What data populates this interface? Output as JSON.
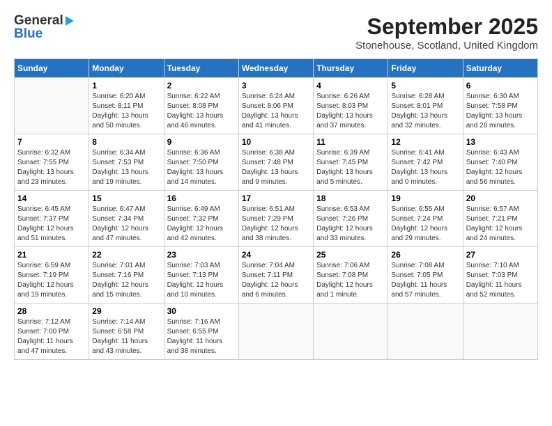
{
  "header": {
    "logo_general": "General",
    "logo_blue": "Blue",
    "title": "September 2025",
    "subtitle": "Stonehouse, Scotland, United Kingdom"
  },
  "weekdays": [
    "Sunday",
    "Monday",
    "Tuesday",
    "Wednesday",
    "Thursday",
    "Friday",
    "Saturday"
  ],
  "weeks": [
    [
      {
        "day": "",
        "sunrise": "",
        "sunset": "",
        "daylight": ""
      },
      {
        "day": "1",
        "sunrise": "Sunrise: 6:20 AM",
        "sunset": "Sunset: 8:11 PM",
        "daylight": "Daylight: 13 hours and 50 minutes."
      },
      {
        "day": "2",
        "sunrise": "Sunrise: 6:22 AM",
        "sunset": "Sunset: 8:08 PM",
        "daylight": "Daylight: 13 hours and 46 minutes."
      },
      {
        "day": "3",
        "sunrise": "Sunrise: 6:24 AM",
        "sunset": "Sunset: 8:06 PM",
        "daylight": "Daylight: 13 hours and 41 minutes."
      },
      {
        "day": "4",
        "sunrise": "Sunrise: 6:26 AM",
        "sunset": "Sunset: 8:03 PM",
        "daylight": "Daylight: 13 hours and 37 minutes."
      },
      {
        "day": "5",
        "sunrise": "Sunrise: 6:28 AM",
        "sunset": "Sunset: 8:01 PM",
        "daylight": "Daylight: 13 hours and 32 minutes."
      },
      {
        "day": "6",
        "sunrise": "Sunrise: 6:30 AM",
        "sunset": "Sunset: 7:58 PM",
        "daylight": "Daylight: 13 hours and 28 minutes."
      }
    ],
    [
      {
        "day": "7",
        "sunrise": "Sunrise: 6:32 AM",
        "sunset": "Sunset: 7:55 PM",
        "daylight": "Daylight: 13 hours and 23 minutes."
      },
      {
        "day": "8",
        "sunrise": "Sunrise: 6:34 AM",
        "sunset": "Sunset: 7:53 PM",
        "daylight": "Daylight: 13 hours and 19 minutes."
      },
      {
        "day": "9",
        "sunrise": "Sunrise: 6:36 AM",
        "sunset": "Sunset: 7:50 PM",
        "daylight": "Daylight: 13 hours and 14 minutes."
      },
      {
        "day": "10",
        "sunrise": "Sunrise: 6:38 AM",
        "sunset": "Sunset: 7:48 PM",
        "daylight": "Daylight: 13 hours and 9 minutes."
      },
      {
        "day": "11",
        "sunrise": "Sunrise: 6:39 AM",
        "sunset": "Sunset: 7:45 PM",
        "daylight": "Daylight: 13 hours and 5 minutes."
      },
      {
        "day": "12",
        "sunrise": "Sunrise: 6:41 AM",
        "sunset": "Sunset: 7:42 PM",
        "daylight": "Daylight: 13 hours and 0 minutes."
      },
      {
        "day": "13",
        "sunrise": "Sunrise: 6:43 AM",
        "sunset": "Sunset: 7:40 PM",
        "daylight": "Daylight: 12 hours and 56 minutes."
      }
    ],
    [
      {
        "day": "14",
        "sunrise": "Sunrise: 6:45 AM",
        "sunset": "Sunset: 7:37 PM",
        "daylight": "Daylight: 12 hours and 51 minutes."
      },
      {
        "day": "15",
        "sunrise": "Sunrise: 6:47 AM",
        "sunset": "Sunset: 7:34 PM",
        "daylight": "Daylight: 12 hours and 47 minutes."
      },
      {
        "day": "16",
        "sunrise": "Sunrise: 6:49 AM",
        "sunset": "Sunset: 7:32 PM",
        "daylight": "Daylight: 12 hours and 42 minutes."
      },
      {
        "day": "17",
        "sunrise": "Sunrise: 6:51 AM",
        "sunset": "Sunset: 7:29 PM",
        "daylight": "Daylight: 12 hours and 38 minutes."
      },
      {
        "day": "18",
        "sunrise": "Sunrise: 6:53 AM",
        "sunset": "Sunset: 7:26 PM",
        "daylight": "Daylight: 12 hours and 33 minutes."
      },
      {
        "day": "19",
        "sunrise": "Sunrise: 6:55 AM",
        "sunset": "Sunset: 7:24 PM",
        "daylight": "Daylight: 12 hours and 29 minutes."
      },
      {
        "day": "20",
        "sunrise": "Sunrise: 6:57 AM",
        "sunset": "Sunset: 7:21 PM",
        "daylight": "Daylight: 12 hours and 24 minutes."
      }
    ],
    [
      {
        "day": "21",
        "sunrise": "Sunrise: 6:59 AM",
        "sunset": "Sunset: 7:19 PM",
        "daylight": "Daylight: 12 hours and 19 minutes."
      },
      {
        "day": "22",
        "sunrise": "Sunrise: 7:01 AM",
        "sunset": "Sunset: 7:16 PM",
        "daylight": "Daylight: 12 hours and 15 minutes."
      },
      {
        "day": "23",
        "sunrise": "Sunrise: 7:03 AM",
        "sunset": "Sunset: 7:13 PM",
        "daylight": "Daylight: 12 hours and 10 minutes."
      },
      {
        "day": "24",
        "sunrise": "Sunrise: 7:04 AM",
        "sunset": "Sunset: 7:11 PM",
        "daylight": "Daylight: 12 hours and 6 minutes."
      },
      {
        "day": "25",
        "sunrise": "Sunrise: 7:06 AM",
        "sunset": "Sunset: 7:08 PM",
        "daylight": "Daylight: 12 hours and 1 minute."
      },
      {
        "day": "26",
        "sunrise": "Sunrise: 7:08 AM",
        "sunset": "Sunset: 7:05 PM",
        "daylight": "Daylight: 11 hours and 57 minutes."
      },
      {
        "day": "27",
        "sunrise": "Sunrise: 7:10 AM",
        "sunset": "Sunset: 7:03 PM",
        "daylight": "Daylight: 11 hours and 52 minutes."
      }
    ],
    [
      {
        "day": "28",
        "sunrise": "Sunrise: 7:12 AM",
        "sunset": "Sunset: 7:00 PM",
        "daylight": "Daylight: 11 hours and 47 minutes."
      },
      {
        "day": "29",
        "sunrise": "Sunrise: 7:14 AM",
        "sunset": "Sunset: 6:58 PM",
        "daylight": "Daylight: 11 hours and 43 minutes."
      },
      {
        "day": "30",
        "sunrise": "Sunrise: 7:16 AM",
        "sunset": "Sunset: 6:55 PM",
        "daylight": "Daylight: 11 hours and 38 minutes."
      },
      {
        "day": "",
        "sunrise": "",
        "sunset": "",
        "daylight": ""
      },
      {
        "day": "",
        "sunrise": "",
        "sunset": "",
        "daylight": ""
      },
      {
        "day": "",
        "sunrise": "",
        "sunset": "",
        "daylight": ""
      },
      {
        "day": "",
        "sunrise": "",
        "sunset": "",
        "daylight": ""
      }
    ]
  ]
}
